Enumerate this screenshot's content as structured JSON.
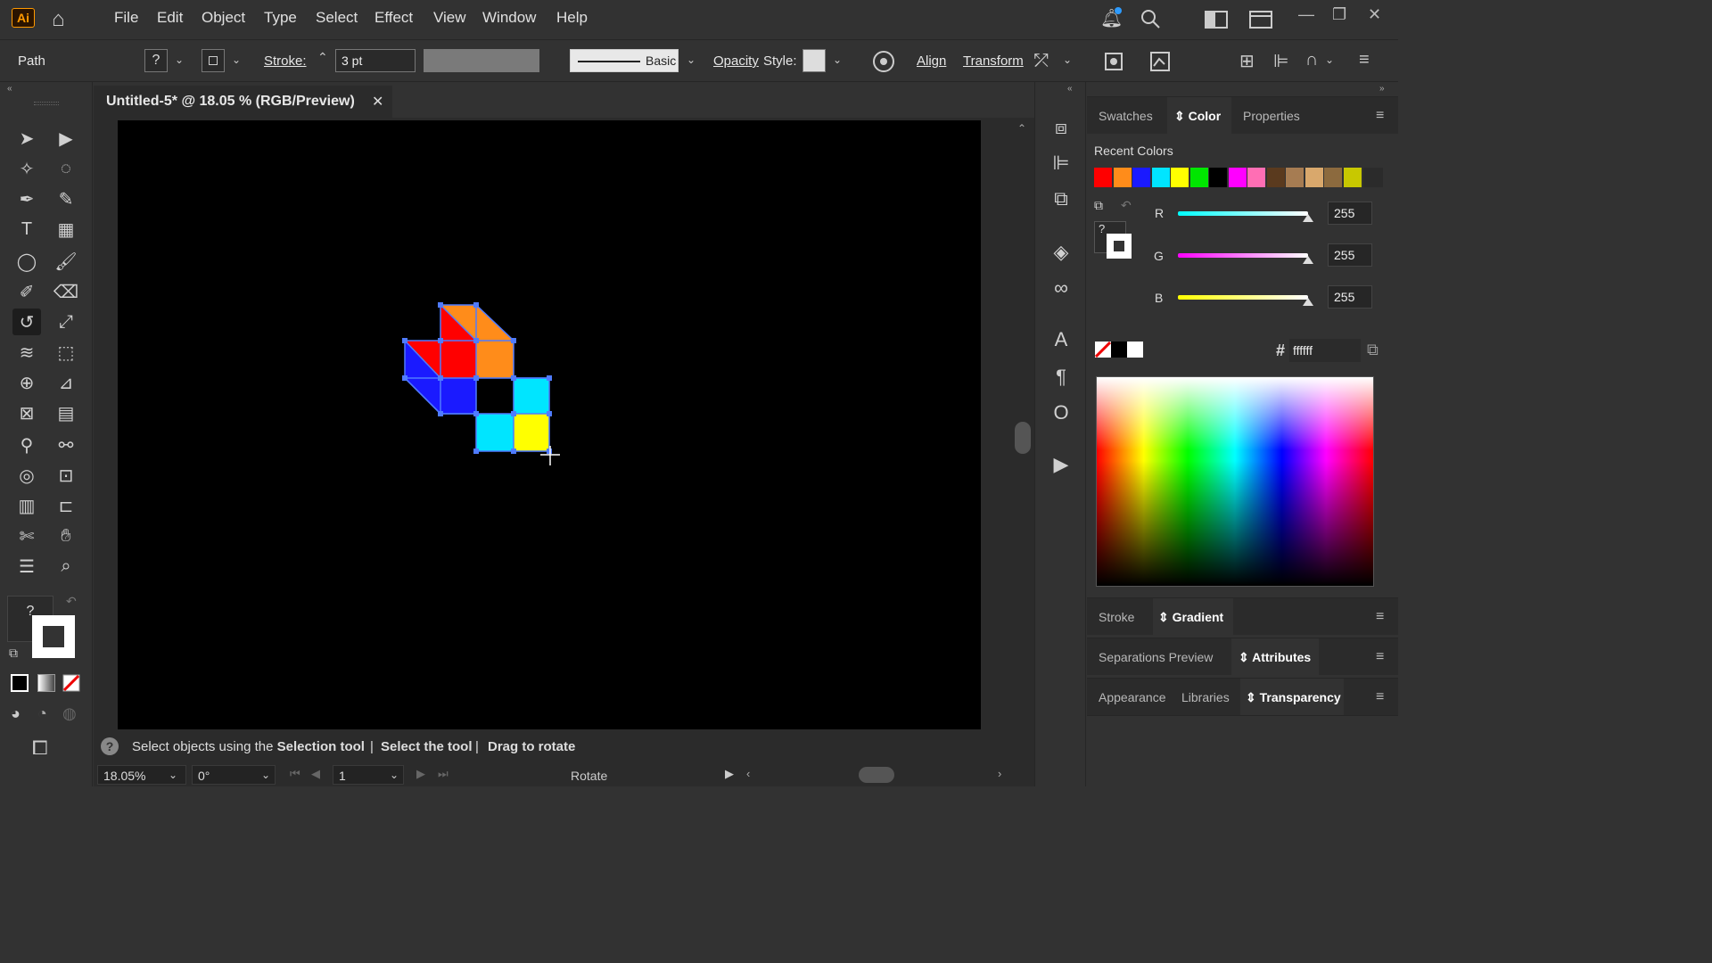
{
  "app": {
    "logo": "Ai"
  },
  "menu": [
    "File",
    "Edit",
    "Object",
    "Type",
    "Select",
    "Effect",
    "View",
    "Window",
    "Help"
  ],
  "control": {
    "selection_label": "Path",
    "fill_q": "?",
    "stroke_label": "Stroke:",
    "stroke_weight": "3 pt",
    "brush_label": "Basic",
    "opacity_label": "Opacity",
    "style_label": "Style:",
    "align_label": "Align",
    "transform_label": "Transform"
  },
  "document": {
    "tab_title": "Untitled-5* @ 18.05 % (RGB/Preview)",
    "close": "✕"
  },
  "status": {
    "help_icon": "?",
    "text_a": "Select objects using the ",
    "text_b": "Selection tool",
    "sep1": "|",
    "text_c": "Select the tool",
    "sep2": "|",
    "text_d": "Drag to rotate",
    "zoom": "18.05%",
    "angle": "0°",
    "artboard_num": "1",
    "current_tool": "Rotate"
  },
  "panel": {
    "tabs_top": [
      "Swatches",
      "Color",
      "Properties"
    ],
    "recent_colors_label": "Recent Colors",
    "recent_colors": [
      "#ff0000",
      "#ff8c1a",
      "#1a1aff",
      "#00e5ff",
      "#ffff00",
      "#00e600",
      "#000000",
      "#ff00ff",
      "#ff6eb4",
      "#5a3a1e",
      "#a67c52",
      "#d9a86c",
      "#8c6a3e",
      "#c8c800"
    ],
    "r_label": "R",
    "r_value": "255",
    "g_label": "G",
    "g_value": "255",
    "b_label": "B",
    "b_value": "255",
    "hash": "#",
    "hex_value": "ffffff",
    "fill_q": "?",
    "tabs_stroke": [
      "Stroke",
      "Gradient"
    ],
    "tabs_sep": [
      "Separations Preview",
      "Attributes"
    ],
    "tabs_app": [
      "Appearance",
      "Libraries",
      "Transparency"
    ]
  },
  "toolbar": {
    "fill_q": "?"
  }
}
